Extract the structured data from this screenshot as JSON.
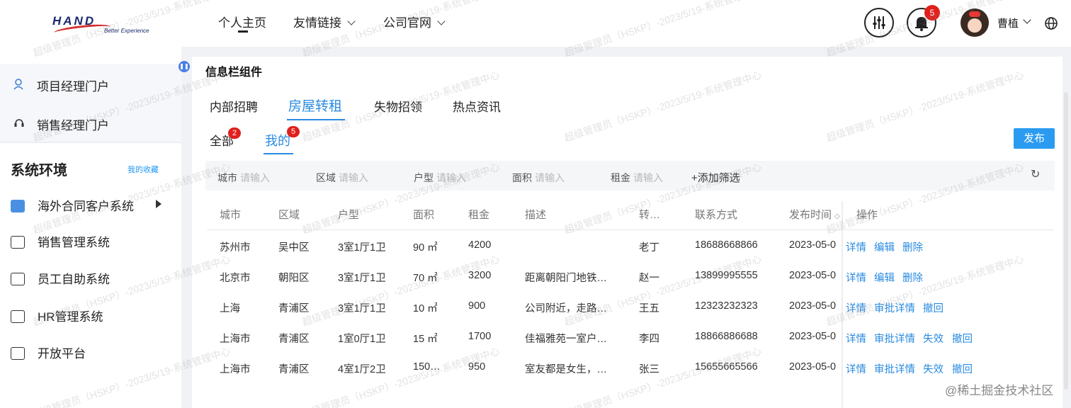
{
  "header": {
    "logo_text": "HAND",
    "logo_tagline": "Better Experience",
    "nav": [
      {
        "label": "个人主页"
      },
      {
        "label": "友情链接"
      },
      {
        "label": "公司官网"
      }
    ],
    "notification_count": "5",
    "user_name": "曹植"
  },
  "sidebar": {
    "portals": [
      {
        "label": "项目经理门户",
        "icon": "user-icon"
      },
      {
        "label": "销售经理门户",
        "icon": "headset-icon"
      }
    ],
    "section_title": "系统环境",
    "favorites_link": "我的收藏",
    "systems": [
      {
        "label": "海外合同客户系统",
        "icon": "calendar-icon",
        "active": true
      },
      {
        "label": "销售管理系统",
        "icon": "edit-icon"
      },
      {
        "label": "员工自助系统",
        "icon": "edit-icon"
      },
      {
        "label": "HR管理系统",
        "icon": "edit-icon"
      },
      {
        "label": "开放平台",
        "icon": "edit-icon"
      }
    ]
  },
  "main": {
    "title": "信息栏组件",
    "tabs": [
      {
        "label": "内部招聘"
      },
      {
        "label": "房屋转租",
        "active": true
      },
      {
        "label": "失物招领"
      },
      {
        "label": "热点资讯"
      }
    ],
    "subtabs": [
      {
        "label": "全部",
        "badge": "2"
      },
      {
        "label": "我的",
        "badge": "5",
        "active": true
      }
    ],
    "publish_label": "发布",
    "filters": [
      {
        "label": "城市",
        "placeholder": "请输入"
      },
      {
        "label": "区域",
        "placeholder": "请输入"
      },
      {
        "label": "户型",
        "placeholder": "请输入"
      },
      {
        "label": "面积",
        "placeholder": "请输入"
      },
      {
        "label": "租金",
        "placeholder": "请输入"
      }
    ],
    "add_filter_label": "+添加筛选",
    "refresh_icon": "refresh-icon",
    "table": {
      "columns": [
        "城市",
        "区域",
        "户型",
        "面积",
        "租金",
        "描述",
        "转…",
        "联系方式",
        "发布时间",
        "操作"
      ],
      "rows": [
        {
          "city": "苏州市",
          "area": "吴中区",
          "layout": "3室1厅1卫",
          "size": "90 ㎡",
          "rent": "4200",
          "desc": "",
          "person": "老丁",
          "contact": "18688668866",
          "date": "2023-05-0",
          "actions": [
            "详情",
            "编辑",
            "删除"
          ]
        },
        {
          "city": "北京市",
          "area": "朝阳区",
          "layout": "3室1厅1卫",
          "size": "70 ㎡",
          "rent": "3200",
          "desc": "距离朝阳门地铁…",
          "person": "赵一",
          "contact": "13899995555",
          "date": "2023-05-0",
          "actions": [
            "详情",
            "编辑",
            "删除"
          ]
        },
        {
          "city": "上海",
          "area": "青浦区",
          "layout": "3室1厅1卫",
          "size": "10 ㎡",
          "rent": "900",
          "desc": "公司附近，走路…",
          "person": "王五",
          "contact": "12323232323",
          "date": "2023-05-0",
          "actions": [
            "详情",
            "审批详情",
            "撤回"
          ]
        },
        {
          "city": "上海市",
          "area": "青浦区",
          "layout": "1室0厅1卫",
          "size": "15 ㎡",
          "rent": "1700",
          "desc": "佳福雅苑一室户…",
          "person": "李四",
          "contact": "18866886688",
          "date": "2023-05-0",
          "actions": [
            "详情",
            "审批详情",
            "失效",
            "撤回"
          ]
        },
        {
          "city": "上海市",
          "area": "青浦区",
          "layout": "4室1厅2卫",
          "size": "150…",
          "rent": "950",
          "desc": "室友都是女生，…",
          "person": "张三",
          "contact": "15655665566",
          "date": "2023-05-0",
          "actions": [
            "详情",
            "审批详情",
            "失效",
            "撤回"
          ]
        }
      ]
    }
  },
  "watermark_text": "超级管理员（HSKP）-2023/5/19-系统管理中心",
  "corner_watermark": "@稀土掘金技术社区",
  "colors": {
    "accent": "#2a8be0",
    "badge": "#e0201c",
    "publish": "#2a9bf0"
  }
}
